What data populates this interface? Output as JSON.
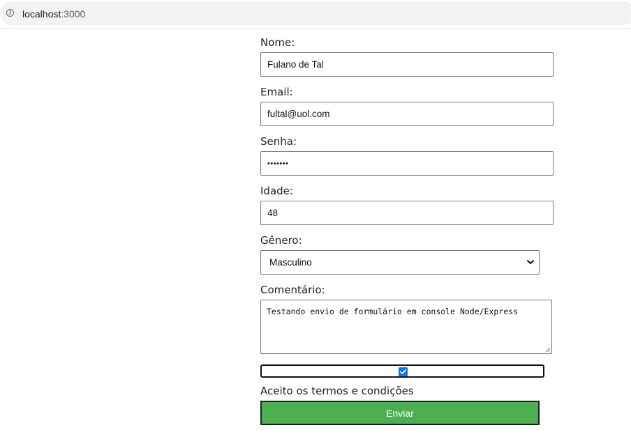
{
  "browser": {
    "url_host": "localhost",
    "url_port": ":3000",
    "info_icon": "info-icon"
  },
  "form": {
    "nome": {
      "label": "Nome:",
      "value": "Fulano de Tal"
    },
    "email": {
      "label": "Email:",
      "value": "fultal@uol.com"
    },
    "senha": {
      "label": "Senha:",
      "value": "•••••••"
    },
    "idade": {
      "label": "Idade:",
      "value": "48"
    },
    "genero": {
      "label": "Gênero:",
      "value": "Masculino"
    },
    "comentario": {
      "label": "Comentário:",
      "value": "Testando envio de formulário em console Node/Express"
    },
    "termos": {
      "checked": true,
      "label": "Aceito os termos e condições"
    },
    "submit_label": "Enviar"
  },
  "colors": {
    "submit_bg": "#4caf50",
    "checkbox_accent": "#0075ff"
  }
}
